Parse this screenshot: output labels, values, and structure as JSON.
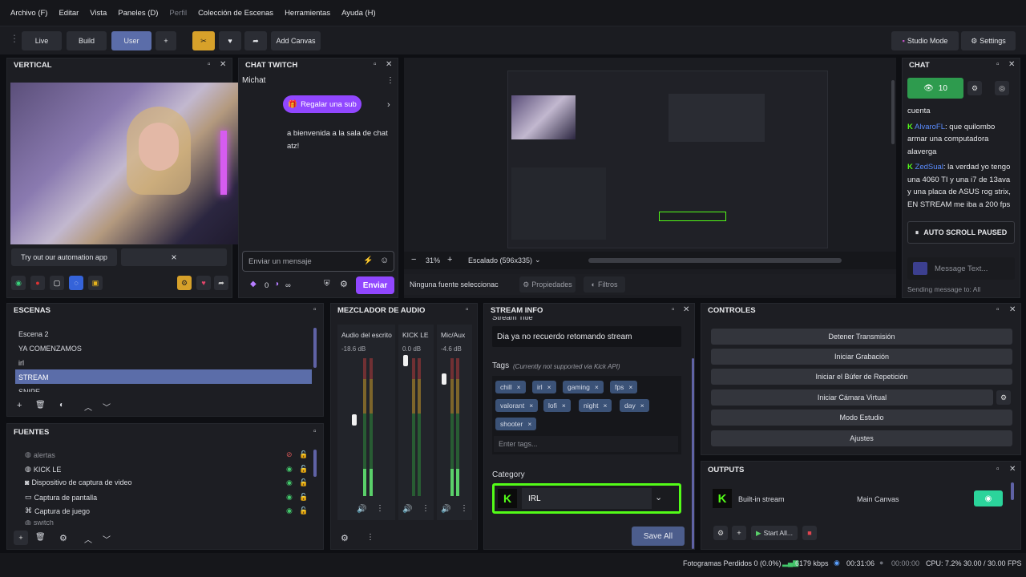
{
  "menu": [
    "Archivo (F)",
    "Editar",
    "Vista",
    "Paneles (D)",
    "Perfil",
    "Colección de Escenas",
    "Herramientas",
    "Ayuda (H)"
  ],
  "toolbar": {
    "live": "Live",
    "build": "Build",
    "user": "User",
    "add": "+",
    "add_canvas": "Add Canvas",
    "studio_mode": "Studio Mode",
    "settings": "Settings"
  },
  "vertical": {
    "title": "VERTICAL",
    "automation_label": "Try out our automation app",
    "close": "×"
  },
  "chat_twitch": {
    "title": "CHAT TWITCH",
    "channel": "Michat",
    "sub_button": "Regalar una sub",
    "welcome": "a bienvenida a la sala de chat",
    "welcome2": "atz!",
    "input_placeholder": "Enviar un mensaje",
    "points": "0",
    "infinity": "∞",
    "send": "Enviar"
  },
  "preview": {
    "zoom": "31%",
    "scale": "Escalado (596x335)",
    "no_source": "Ninguna fuente seleccionac",
    "properties": "Propiedades",
    "filters": "Filtros"
  },
  "chat": {
    "title": "CHAT",
    "viewers": "10",
    "messages": [
      {
        "user": "",
        "text": "cuenta"
      },
      {
        "user": "AlvaroFL",
        "text": ": que quilombo armar una computadora alaverga"
      },
      {
        "user": "ZedSual",
        "text": ": la verdad yo tengo una 4060 TI y una i7 de 13ava y una placa de ASUS rog strix, EN STREAM me iba a 200 fps"
      }
    ],
    "scroll_paused": "AUTO SCROLL PAUSED",
    "input_placeholder": "Message Text...",
    "sending_to": "Sending message to: All"
  },
  "scenes": {
    "title": "ESCENAS",
    "items": [
      "Escena 2",
      "YA COMENZAMOS",
      "irl",
      "STREAM",
      "SNIPE"
    ],
    "selected": "STREAM"
  },
  "sources": {
    "title": "FUENTES",
    "items": [
      "alertas",
      "KICK LE",
      "Dispositivo de captura de video",
      "Captura de pantalla",
      "Captura de juego",
      "switch"
    ]
  },
  "mixer": {
    "title": "MEZCLADOR DE AUDIO",
    "channels": [
      {
        "name": "Audio del escrito",
        "db": "-18.6 dB",
        "level": 0.2,
        "fader": 0.55
      },
      {
        "name": "KICK LE",
        "db": "0.0 dB",
        "level": 0.0,
        "fader": 0.98
      },
      {
        "name": "Mic/Aux",
        "db": "-4.6 dB",
        "level": 0.2,
        "fader": 0.85
      }
    ],
    "scale": [
      "0",
      "-5",
      "-10",
      "-15",
      "-20",
      "-25",
      "-30",
      "-35",
      "-40",
      "-45",
      "-50",
      "-55",
      "-60"
    ]
  },
  "stream_info": {
    "title": "STREAM INFO",
    "stream_title_label": "Stream Title",
    "stream_title": "Dia ya no recuerdo retomando stream",
    "tags_label": "Tags",
    "tags_note": "(Currently not supported via Kick API)",
    "tags": [
      "chill",
      "irl",
      "gaming",
      "fps",
      "valorant",
      "lofi",
      "night",
      "day",
      "shooter"
    ],
    "tags_placeholder": "Enter tags...",
    "category_label": "Category",
    "category": "IRL",
    "save": "Save All"
  },
  "controls": {
    "title": "CONTROLES",
    "buttons": [
      "Detener Transmisión",
      "Iniciar Grabación",
      "Iniciar el Búfer de Repetición",
      "Iniciar Cámara Virtual",
      "Modo Estudio",
      "Ajustes"
    ]
  },
  "outputs": {
    "title": "OUTPUTS",
    "name": "Built-in stream",
    "canvas": "Main Canvas",
    "start_all": "Start All..."
  },
  "status": {
    "dropped": "Fotogramas Perdidos 0 (0.0%)",
    "bitrate": "6179 kbps",
    "live_time": "00:31:06",
    "rec_time": "00:00:00",
    "cpu": "CPU: 7.2%",
    "fps": "30.00 / 30.00 FPS"
  },
  "colors": {
    "accent_blue": "#5b6da9",
    "twitch_purple": "#9147ff",
    "kick_green": "#53fc18",
    "live_green": "#2e9b4e"
  }
}
